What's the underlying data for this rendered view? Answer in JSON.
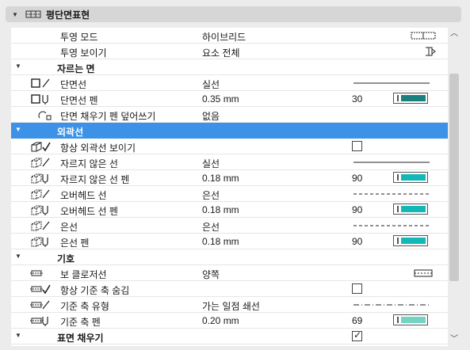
{
  "panel": {
    "title": "평단면표현"
  },
  "rows": [
    {
      "kind": "prop",
      "name": "투영 모드",
      "value": "하이브리드",
      "ctrl": "projection-icon"
    },
    {
      "kind": "prop",
      "name": "투영 보이기",
      "value": "요소 전체",
      "ctrl": "show-elements-icon"
    },
    {
      "kind": "section",
      "name": "자르는 면"
    },
    {
      "kind": "prop",
      "icon": "cut-line-icon",
      "name": "단면선",
      "value": "실선",
      "ctrl": "solid-line"
    },
    {
      "kind": "prop",
      "icon": "cut-pen-icon",
      "name": "단면선 펜",
      "value": "0.35 mm",
      "num": "30",
      "ctrl": "pen",
      "pen_color": "#1a7f7f"
    },
    {
      "kind": "prop",
      "icon": "fill-pen-override-icon",
      "name": "단면 채우기 펜 덮어쓰기",
      "value": "없음"
    },
    {
      "kind": "section",
      "name": "외곽선",
      "selected": true
    },
    {
      "kind": "prop",
      "icon": "show-outline-icon",
      "name": "항상 외곽선 보이기",
      "ctrl": "checkbox",
      "checked": false
    },
    {
      "kind": "prop",
      "icon": "uncut-line-icon",
      "name": "자르지 않은 선",
      "value": "실선",
      "ctrl": "solid-line"
    },
    {
      "kind": "prop",
      "icon": "uncut-pen-icon",
      "name": "자르지 않은 선 펜",
      "value": "0.18 mm",
      "num": "90",
      "ctrl": "pen",
      "pen_color": "#12b8b8"
    },
    {
      "kind": "prop",
      "icon": "overhead-line-icon",
      "name": "오버헤드 선",
      "value": "은선",
      "ctrl": "dashed-line"
    },
    {
      "kind": "prop",
      "icon": "overhead-pen-icon",
      "name": "오버헤드 선  펜",
      "value": "0.18 mm",
      "num": "90",
      "ctrl": "pen",
      "pen_color": "#12b8b8"
    },
    {
      "kind": "prop",
      "icon": "hidden-line-icon",
      "name": "은선",
      "value": "은선",
      "ctrl": "dashed-line"
    },
    {
      "kind": "prop",
      "icon": "hidden-pen-icon",
      "name": "은선 펜",
      "value": "0.18 mm",
      "num": "90",
      "ctrl": "pen",
      "pen_color": "#12b8b8"
    },
    {
      "kind": "section",
      "name": "기호"
    },
    {
      "kind": "prop",
      "icon": "beam-closure-icon",
      "name": "보 클로저선",
      "value": "양쪽",
      "ctrl": "closure-symbol"
    },
    {
      "kind": "prop",
      "icon": "hide-ref-axis-icon",
      "name": "항상 기준 축 숨김",
      "ctrl": "checkbox",
      "checked": false
    },
    {
      "kind": "prop",
      "icon": "ref-axis-type-icon",
      "name": "기준 축 유형",
      "value": "가는 일점 쇄선",
      "ctrl": "dashdot-line"
    },
    {
      "kind": "prop",
      "icon": "ref-axis-pen-icon",
      "name": "기준 축 펜",
      "value": "0.20 mm",
      "num": "69",
      "ctrl": "pen",
      "pen_color": "#74d4c4"
    },
    {
      "kind": "section",
      "name": "표면 채우기",
      "checkbox": true,
      "checked": true
    }
  ]
}
